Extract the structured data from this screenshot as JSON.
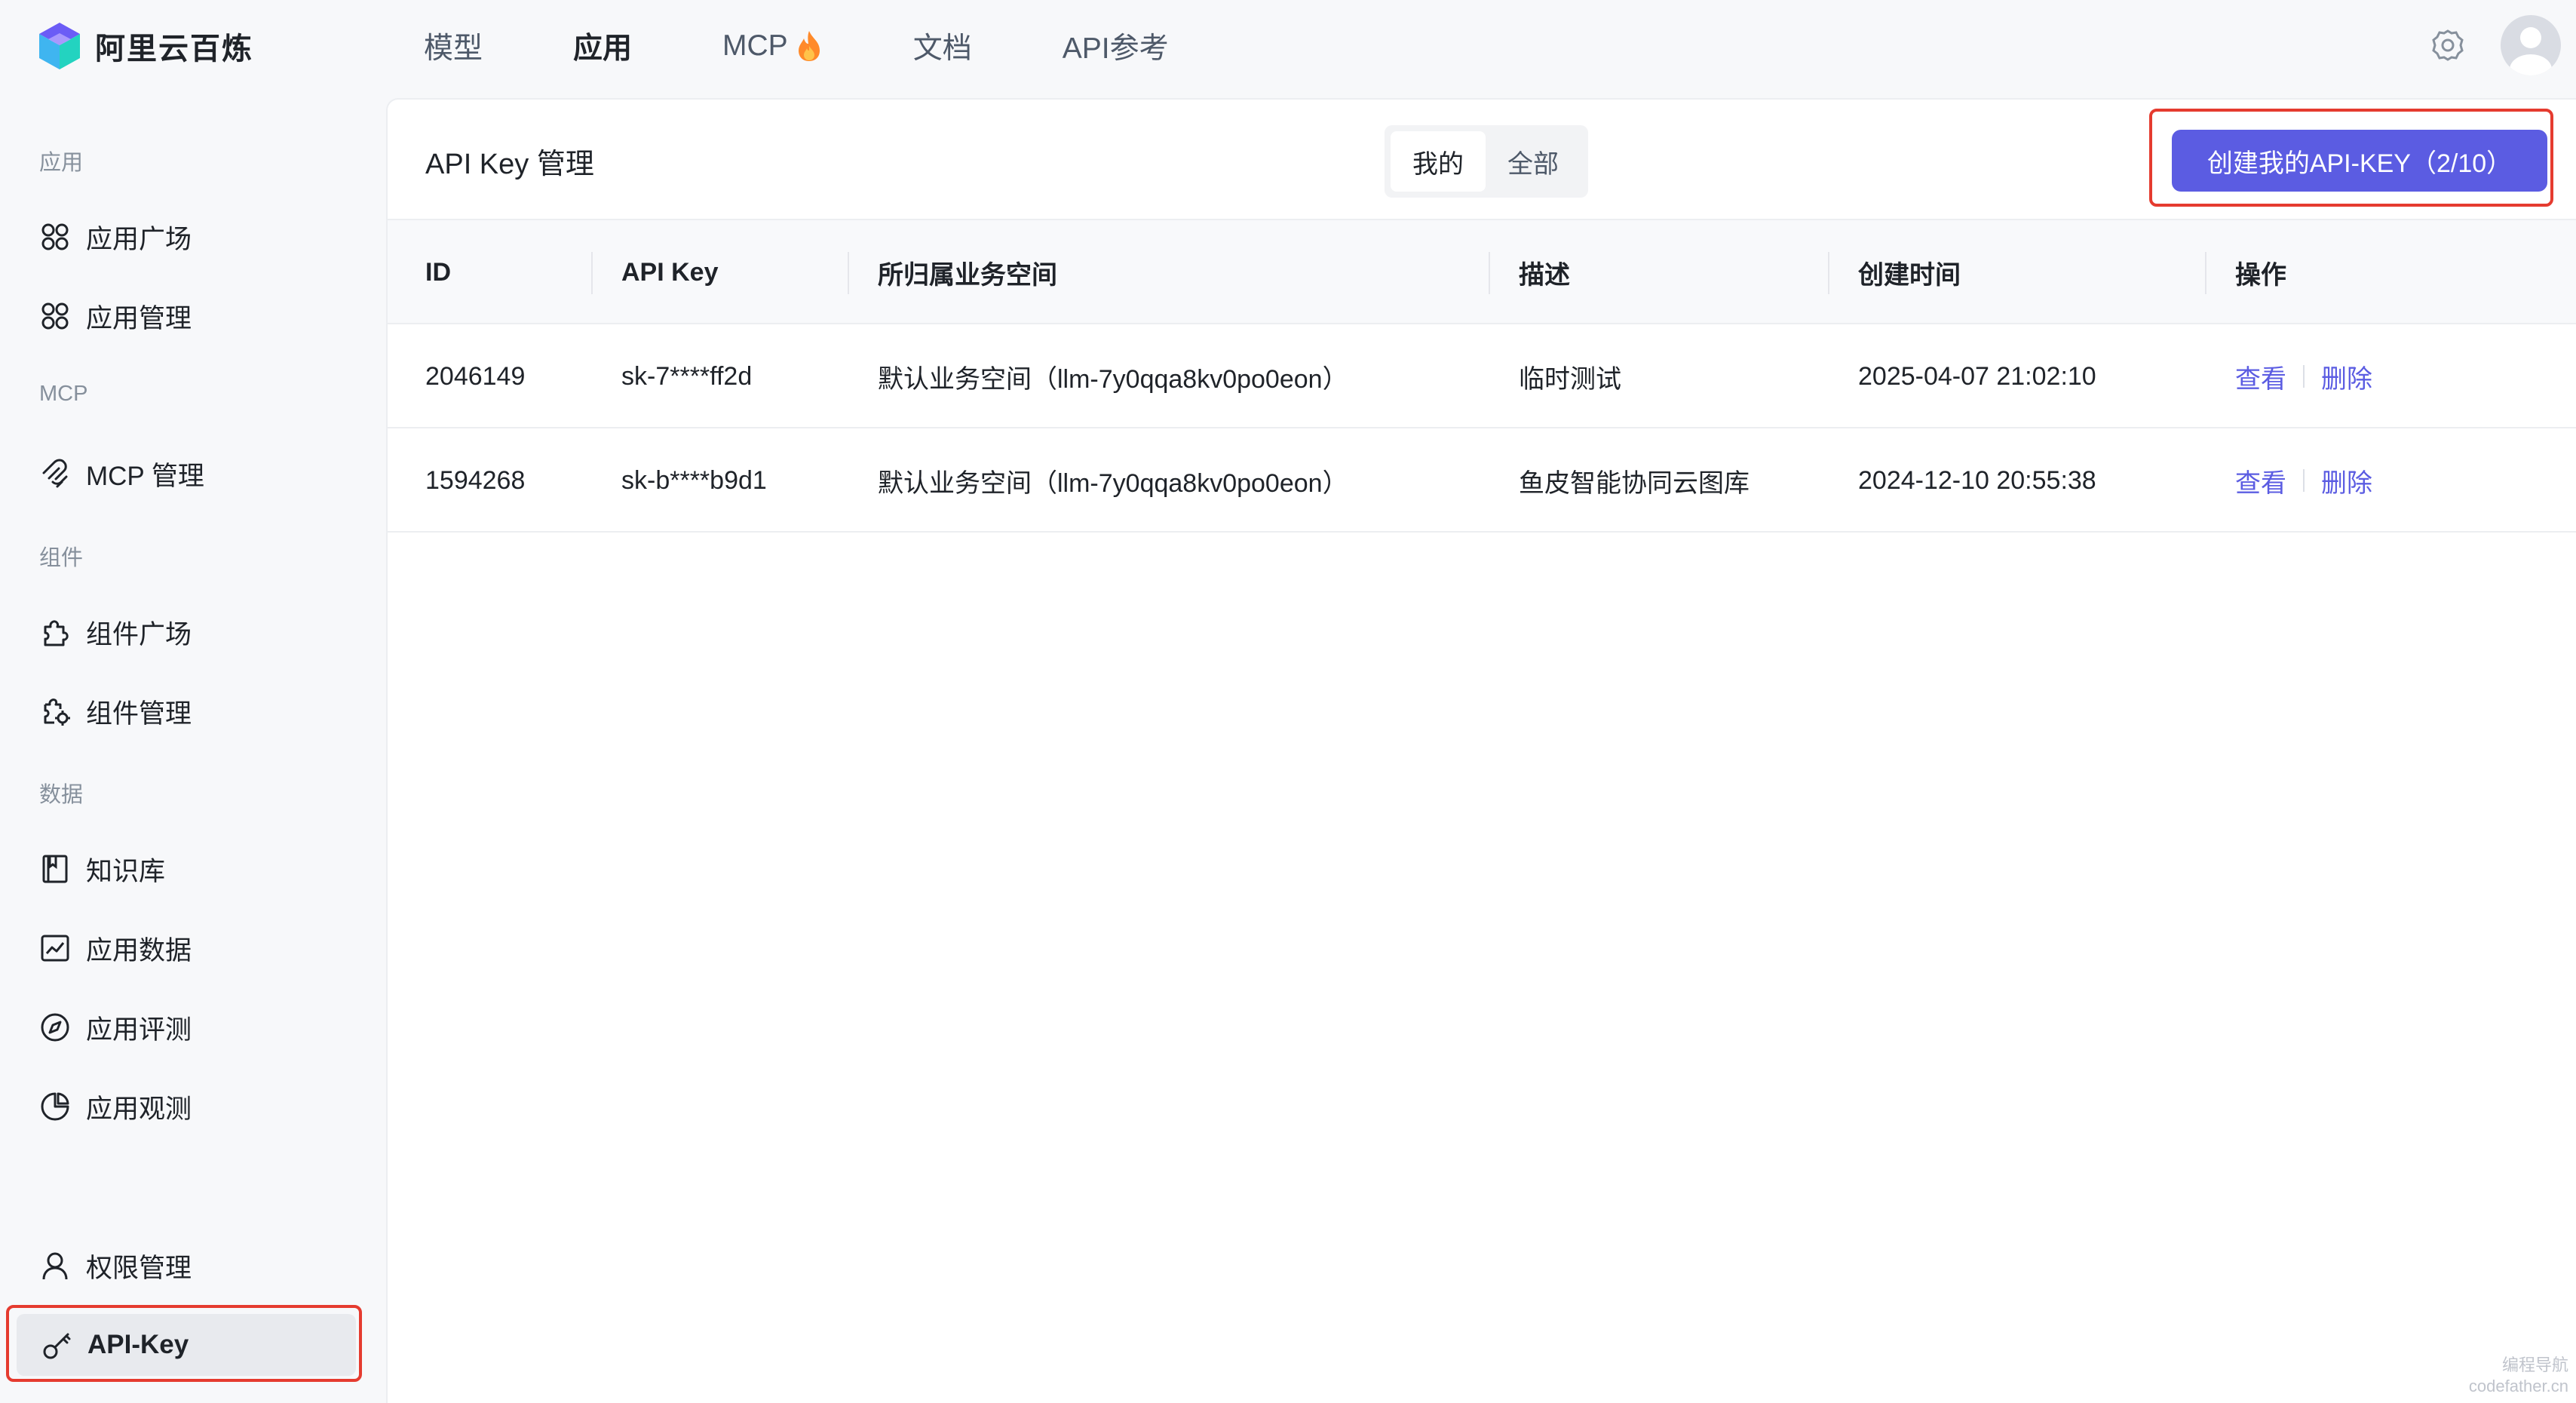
{
  "brand": {
    "name": "阿里云百炼"
  },
  "topnav": {
    "items": [
      {
        "label": "模型"
      },
      {
        "label": "应用"
      },
      {
        "label": "MCP"
      },
      {
        "label": "文档"
      },
      {
        "label": "API参考"
      }
    ],
    "active_index": 1
  },
  "sidebar": {
    "sections": [
      {
        "title": "应用"
      },
      {
        "title": "MCP"
      },
      {
        "title": "组件"
      },
      {
        "title": "数据"
      }
    ],
    "items": [
      {
        "label": "应用广场",
        "icon": "grid-icon"
      },
      {
        "label": "应用管理",
        "icon": "grid-icon"
      },
      {
        "label": "MCP 管理",
        "icon": "mcp-icon"
      },
      {
        "label": "组件广场",
        "icon": "puzzle-icon"
      },
      {
        "label": "组件管理",
        "icon": "puzzle-gear-icon"
      },
      {
        "label": "知识库",
        "icon": "book-icon"
      },
      {
        "label": "应用数据",
        "icon": "chart-icon"
      },
      {
        "label": "应用评测",
        "icon": "compass-icon"
      },
      {
        "label": "应用观测",
        "icon": "pie-icon"
      },
      {
        "label": "权限管理",
        "icon": "user-icon"
      },
      {
        "label": "API-Key",
        "icon": "key-icon"
      }
    ],
    "active_label": "API-Key"
  },
  "panel": {
    "title": "API Key 管理",
    "tabs": [
      {
        "label": "我的"
      },
      {
        "label": "全部"
      }
    ],
    "active_tab": "我的",
    "create_button": "创建我的API-KEY（2/10）"
  },
  "table": {
    "columns": [
      "ID",
      "API Key",
      "所归属业务空间",
      "描述",
      "创建时间",
      "操作"
    ],
    "rows": [
      {
        "id": "2046149",
        "api_key": "sk-7****ff2d",
        "workspace": "默认业务空间（llm-7y0qqa8kv0po0eon）",
        "description": "临时测试",
        "created": "2025-04-07 21:02:10",
        "view": "查看",
        "delete": "删除"
      },
      {
        "id": "1594268",
        "api_key": "sk-b****b9d1",
        "workspace": "默认业务空间（llm-7y0qqa8kv0po0eon）",
        "description": "鱼皮智能协同云图库",
        "created": "2024-12-10 20:55:38",
        "view": "查看",
        "delete": "删除"
      }
    ]
  },
  "watermark": {
    "line1": "编程导航",
    "line2": "codefather.cn"
  },
  "colors": {
    "accent": "#5b5ce2",
    "highlight": "#e53b2f"
  }
}
